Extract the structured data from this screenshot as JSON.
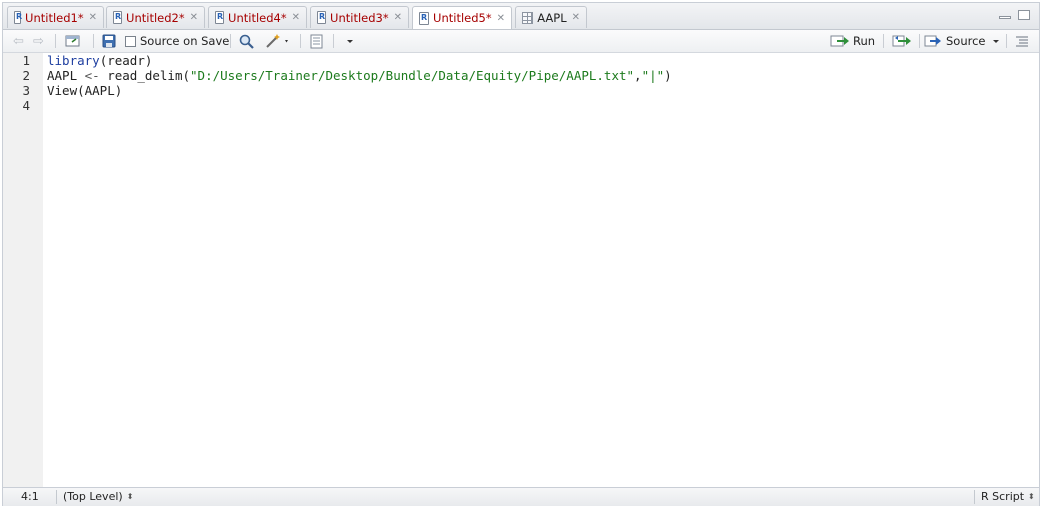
{
  "tabs": [
    {
      "label": "Untitled1*",
      "modified": true
    },
    {
      "label": "Untitled2*",
      "modified": true
    },
    {
      "label": "Untitled4*",
      "modified": true
    },
    {
      "label": "Untitled3*",
      "modified": true
    },
    {
      "label": "Untitled5*",
      "modified": true,
      "active": true
    },
    {
      "label": "AAPL",
      "modified": false
    }
  ],
  "toolbar": {
    "source_on_save_label": "Source on Save",
    "run_label": "Run",
    "source_label": "Source"
  },
  "editor": {
    "line_numbers": [
      "1",
      "2",
      "3",
      "4"
    ],
    "line1_func": "library",
    "line1_rest": "(readr)",
    "line2_var": "AAPL ",
    "line2_op": "<-",
    "line2_func": " read_delim(",
    "line2_path": "\"D:/Users/Trainer/Desktop/Bundle/Data/Equity/Pipe/AAPL.txt\"",
    "line2_comma": ",",
    "line2_sep": "\"|\"",
    "line2_close": ")",
    "line3": "View(AAPL)"
  },
  "status": {
    "position": "4:1",
    "scope": "(Top Level)",
    "file_type": "R Script"
  },
  "colors": {
    "modified_tab_text": "#a60000",
    "keyword": "#1f3fa0",
    "string": "#1c7a1c"
  }
}
